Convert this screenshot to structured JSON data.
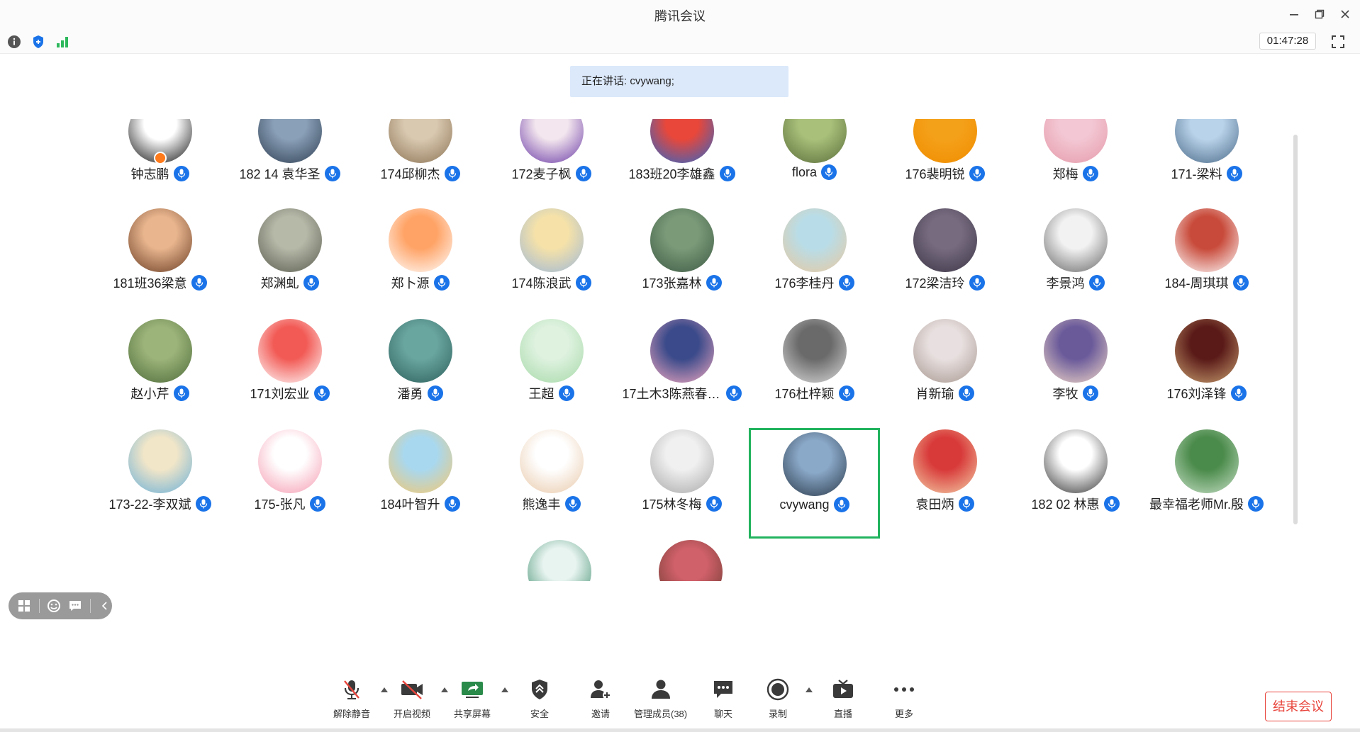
{
  "window": {
    "title": "腾讯会议"
  },
  "timer": "01:47:28",
  "speaking": "正在讲话: cvywang;",
  "participants": [
    {
      "name": "钟志鹏",
      "host": true,
      "colors": [
        "#ffffff",
        "#111111"
      ]
    },
    {
      "name": "182 14 袁华圣",
      "colors": [
        "#8aa0b8",
        "#2f3f52"
      ]
    },
    {
      "name": "174邱柳杰",
      "colors": [
        "#d9c9b0",
        "#8c7355"
      ]
    },
    {
      "name": "172麦子枫",
      "colors": [
        "#f3e6ee",
        "#6a3aa6"
      ]
    },
    {
      "name": "183班20李雄鑫",
      "colors": [
        "#e8473a",
        "#2b66c9"
      ]
    },
    {
      "name": "flora",
      "colors": [
        "#a8c07a",
        "#5a6d3a"
      ]
    },
    {
      "name": "176裴明锐",
      "colors": [
        "#f4a11a",
        "#f08c00"
      ]
    },
    {
      "name": "郑梅",
      "colors": [
        "#f3c7d4",
        "#e59aa9"
      ]
    },
    {
      "name": "171-梁料",
      "colors": [
        "#b9d3ea",
        "#4b6a88"
      ]
    },
    {
      "name": "181班36梁意",
      "colors": [
        "#e8b58e",
        "#6a3d24"
      ]
    },
    {
      "name": "郑渊虬",
      "colors": [
        "#b6b8a8",
        "#5a5e4f"
      ]
    },
    {
      "name": "郑卜源",
      "colors": [
        "#ffa366",
        "#ffffff"
      ]
    },
    {
      "name": "174陈浪武",
      "colors": [
        "#f6e2a8",
        "#9eb8d8"
      ]
    },
    {
      "name": "173张嘉林",
      "colors": [
        "#7a9a78",
        "#3d5a44"
      ]
    },
    {
      "name": "176李桂丹",
      "colors": [
        "#b8dde8",
        "#e8c8a0"
      ]
    },
    {
      "name": "172梁洁玲",
      "colors": [
        "#776b80",
        "#3c3646"
      ]
    },
    {
      "name": "李景鸿",
      "colors": [
        "#f2f2f2",
        "#666666"
      ]
    },
    {
      "name": "184-周琪琪",
      "colors": [
        "#c84a3a",
        "#ffffff"
      ]
    },
    {
      "name": "赵小芹",
      "colors": [
        "#9cb47a",
        "#4e6b3a"
      ]
    },
    {
      "name": "171刘宏业",
      "colors": [
        "#f25a55",
        "#ffffff"
      ]
    },
    {
      "name": "潘勇",
      "colors": [
        "#6aa6a0",
        "#2d5f5c"
      ]
    },
    {
      "name": "王超",
      "colors": [
        "#dff2e0",
        "#a6d9a8"
      ]
    },
    {
      "name": "17土木3陈燕春1...",
      "colors": [
        "#3a4a8a",
        "#f0a8c0"
      ]
    },
    {
      "name": "176杜梓颖",
      "colors": [
        "#6a6a6a",
        "#dcdcdc"
      ]
    },
    {
      "name": "肖新瑜",
      "colors": [
        "#e8e0e0",
        "#a89890"
      ]
    },
    {
      "name": "李牧",
      "colors": [
        "#6a5a9a",
        "#f2d8c8"
      ]
    },
    {
      "name": "176刘泽锋",
      "colors": [
        "#5a1a18",
        "#c8a070"
      ]
    },
    {
      "name": "173-22-李双斌",
      "colors": [
        "#f2e6c8",
        "#6ab0d8"
      ]
    },
    {
      "name": "175-张凡",
      "colors": [
        "#ffffff",
        "#f59ab0"
      ]
    },
    {
      "name": "184叶智升",
      "colors": [
        "#a8d8f0",
        "#f4c870"
      ]
    },
    {
      "name": "熊逸丰",
      "colors": [
        "#ffffff",
        "#e8c8a8"
      ]
    },
    {
      "name": "175林冬梅",
      "colors": [
        "#f0f0f0",
        "#a8a8a8"
      ]
    },
    {
      "name": "cvywang",
      "active": true,
      "colors": [
        "#8aa8c8",
        "#2a3a4a"
      ]
    },
    {
      "name": "袁田炳",
      "colors": [
        "#d83a3a",
        "#f4d0a8"
      ]
    },
    {
      "name": "182 02 林惠",
      "colors": [
        "#ffffff",
        "#333333"
      ]
    },
    {
      "name": "最幸福老师Mr.殷",
      "colors": [
        "#4a8a4a",
        "#c8e0c8"
      ]
    },
    {
      "name": "",
      "colors": [
        "#e8f4f0",
        "#3a8a6a"
      ]
    },
    {
      "name": "",
      "colors": [
        "#d0606a",
        "#6a3a30"
      ]
    }
  ],
  "toolbar": {
    "unmute": "解除静音",
    "video": "开启视频",
    "share": "共享屏幕",
    "security": "安全",
    "invite": "邀请",
    "members": "管理成员(38)",
    "chat": "聊天",
    "record": "录制",
    "live": "直播",
    "more": "更多",
    "end": "结束会议"
  },
  "icons": [
    "info-icon",
    "shield-icon",
    "signal-icon",
    "fullscreen-icon",
    "grid-view-icon",
    "emoji-icon",
    "chat-bubble-icon",
    "collapse-icon",
    "mic-muted-icon",
    "video-off-icon",
    "share-screen-icon",
    "security-icon",
    "invite-icon",
    "members-icon",
    "chat-icon",
    "record-icon",
    "live-icon",
    "more-icon"
  ],
  "colors": {
    "accent": "#1a73e8",
    "active_speaker": "#22b35e",
    "end_button": "#e8453c",
    "banner": "#dce9fb"
  }
}
